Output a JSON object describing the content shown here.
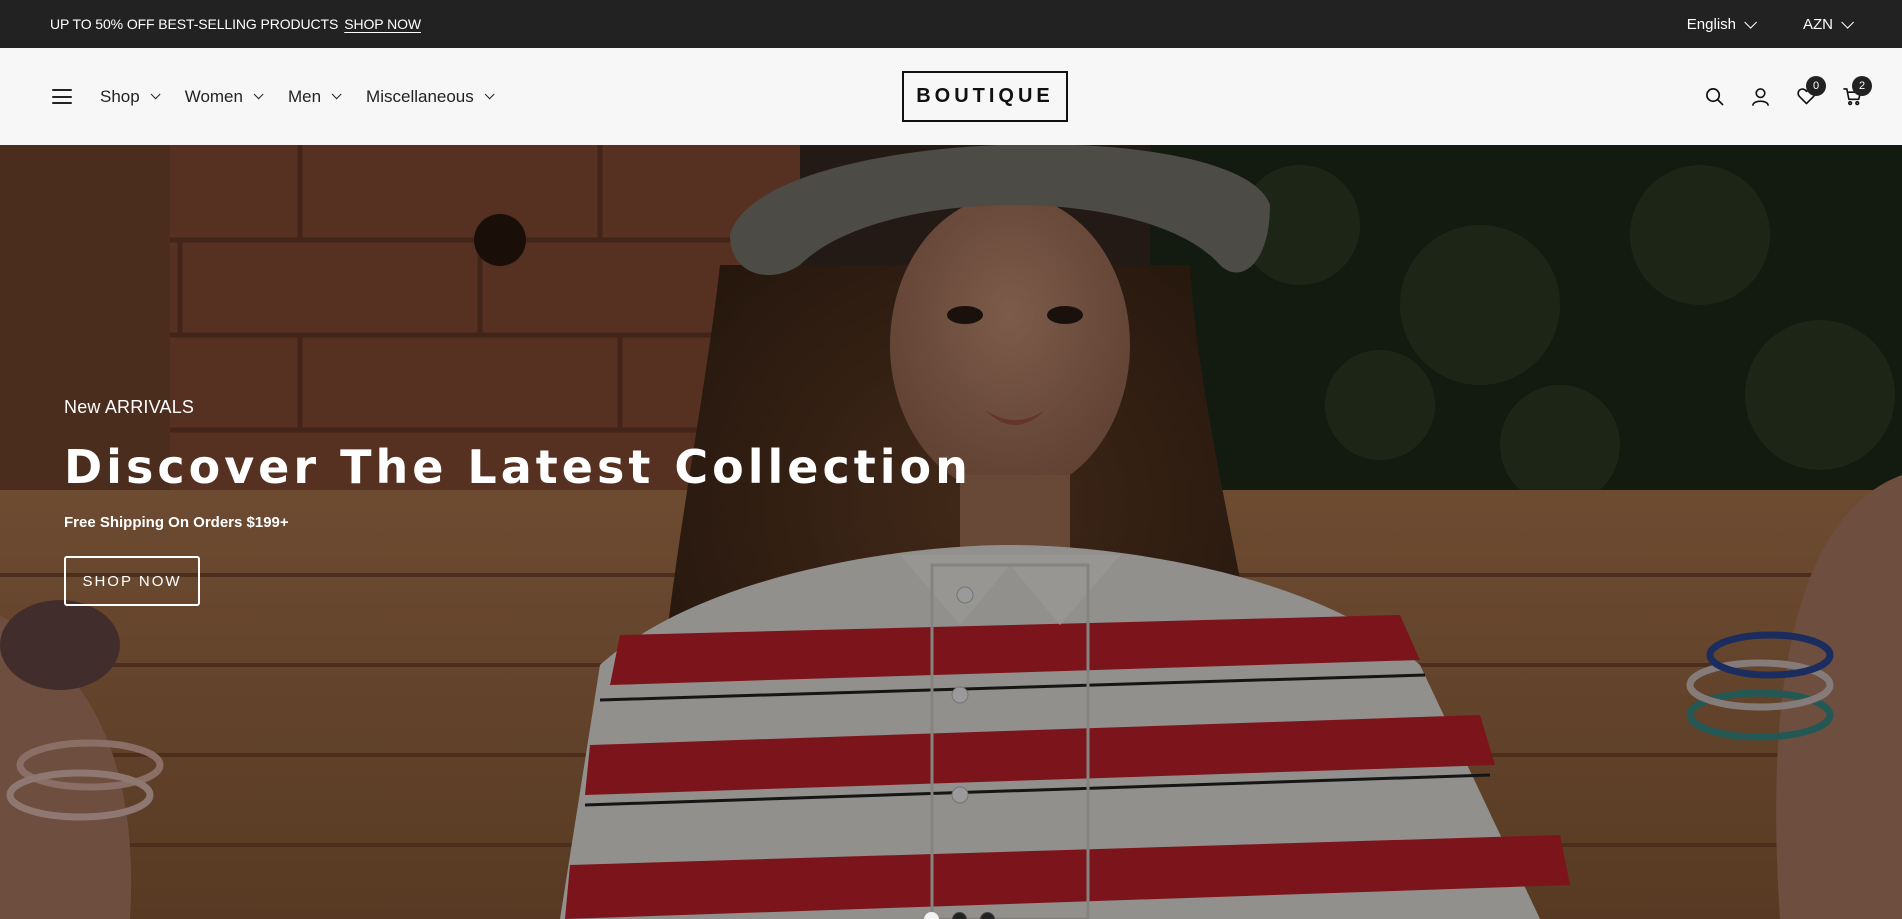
{
  "announcement": {
    "text": "UP TO 50% OFF BEST-SELLING PRODUCTS",
    "link_label": "SHOP NOW"
  },
  "selectors": {
    "language": "English",
    "currency": "AZN"
  },
  "header": {
    "logo": "BOUTIQUE",
    "nav": [
      {
        "label": "Shop"
      },
      {
        "label": "Women"
      },
      {
        "label": "Men"
      },
      {
        "label": "Miscellaneous"
      }
    ],
    "icons": {
      "search": "search-icon",
      "account": "user-icon",
      "wishlist": "heart-icon",
      "cart": "cart-icon"
    },
    "wishlist_count": "0",
    "cart_count": "2"
  },
  "hero": {
    "eyebrow": "New ARRIVALS",
    "title": "Discover The Latest Collection",
    "subtitle": "Free Shipping On Orders $199+",
    "button_label": "SHOP NOW",
    "slides_total": 3,
    "active_slide": 1
  },
  "colors": {
    "topbar_bg": "#222222",
    "header_bg": "#f7f7f7",
    "shirt_red": "#c8212e"
  }
}
